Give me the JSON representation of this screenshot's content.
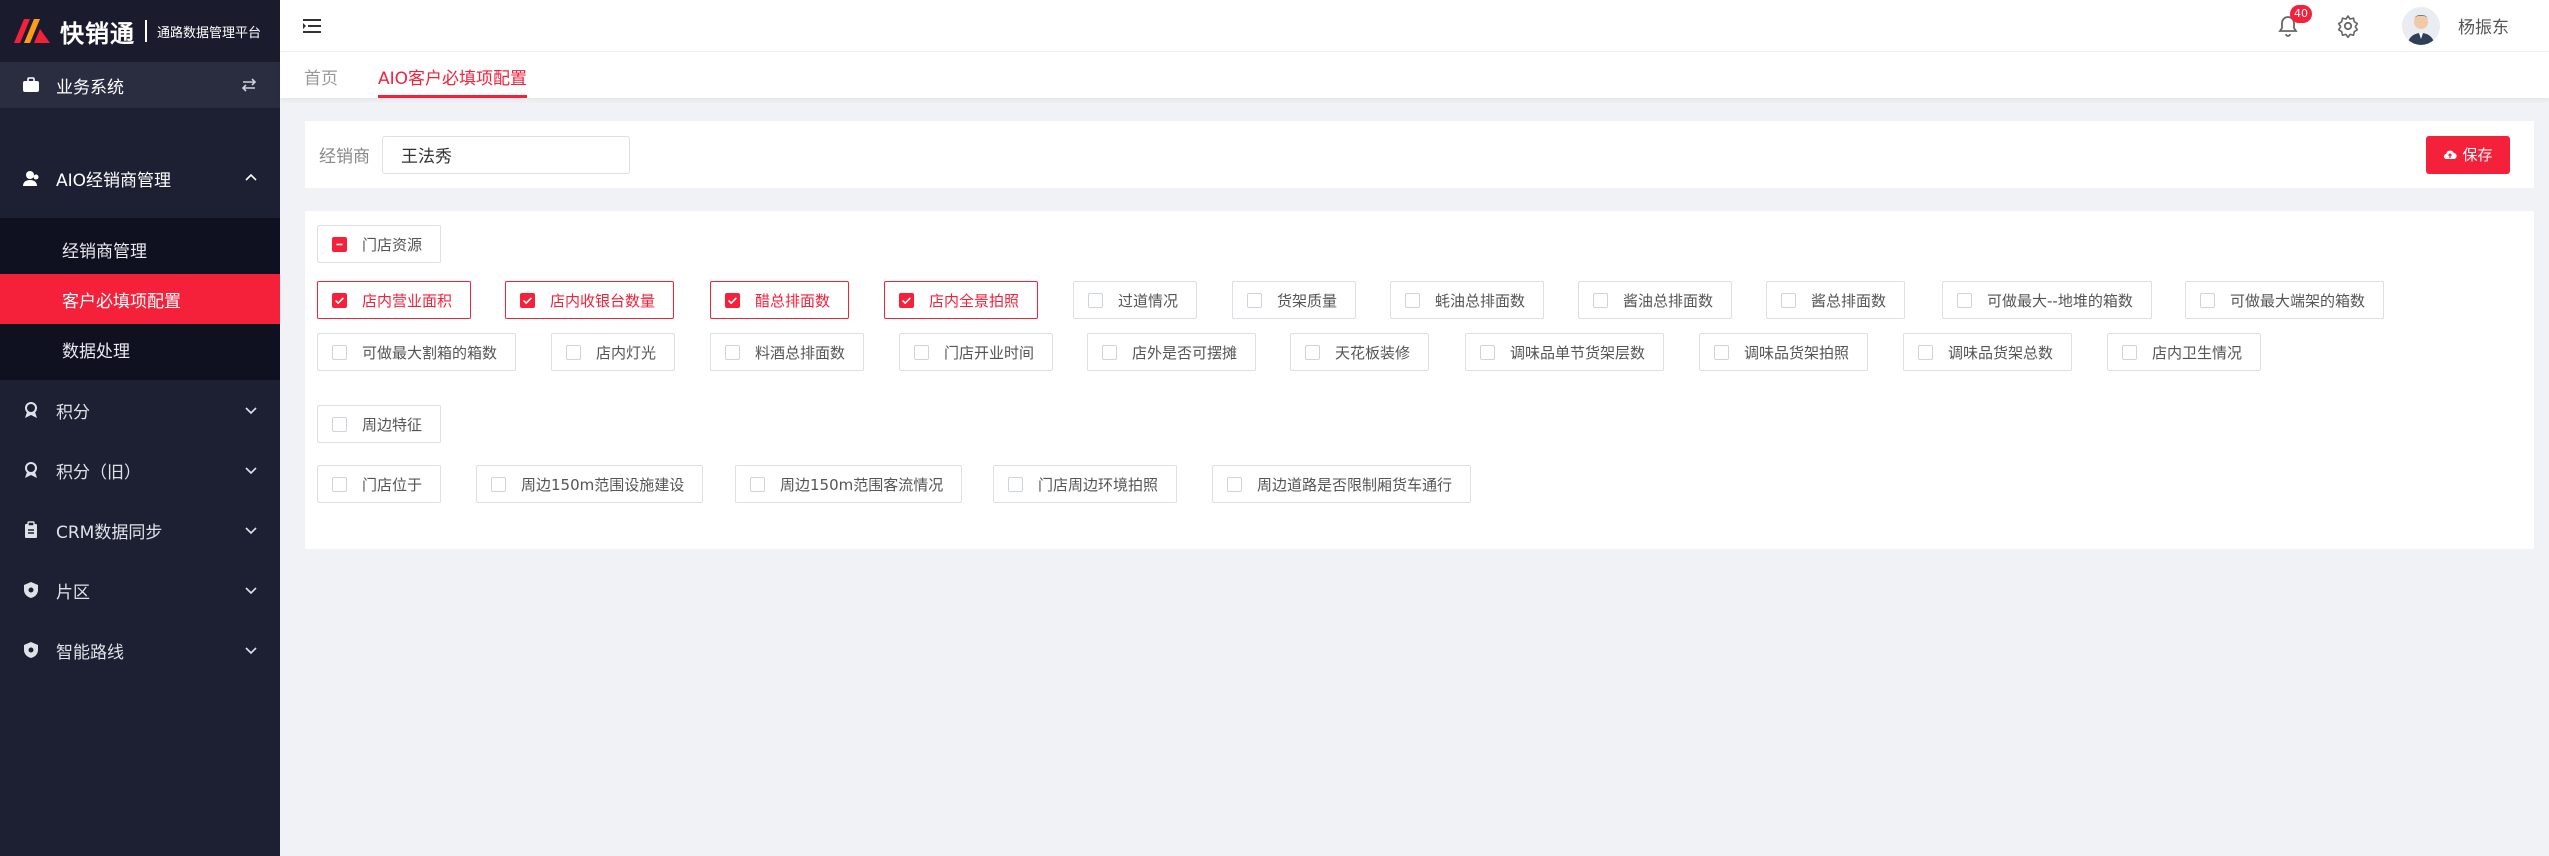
{
  "brand": {
    "name": "快销通",
    "subtitle": "通路数据管理平台"
  },
  "sidebar": {
    "business_system": "业务系统",
    "open_group": {
      "label": "AIO经销商管理",
      "items": [
        {
          "label": "经销商管理"
        },
        {
          "label": "客户必填项配置"
        },
        {
          "label": "数据处理"
        }
      ]
    },
    "groups": [
      {
        "label": "积分"
      },
      {
        "label": "积分（旧）"
      },
      {
        "label": "CRM数据同步"
      },
      {
        "label": "片区"
      },
      {
        "label": "智能路线"
      }
    ]
  },
  "header": {
    "notification_count": "40",
    "user_name": "杨振东"
  },
  "tabs": [
    {
      "label": "首页"
    },
    {
      "label": "AIO客户必填项配置"
    }
  ],
  "filter": {
    "label": "经销商",
    "value": "王法秀",
    "save_label": "保存"
  },
  "sections": {
    "store": {
      "title": "门店资源",
      "items": [
        "店内营业面积",
        "店内收银台数量",
        "醋总排面数",
        "店内全景拍照",
        "过道情况",
        "货架质量",
        "蚝油总排面数",
        "酱油总排面数",
        "酱总排面数",
        "可做最大--地堆的箱数",
        "可做最大端架的箱数",
        "可做最大割箱的箱数",
        "店内灯光",
        "料酒总排面数",
        "门店开业时间",
        "店外是否可摆摊",
        "天花板装修",
        "调味品单节货架层数",
        "调味品货架拍照",
        "调味品货架总数",
        "店内卫生情况"
      ]
    },
    "surround": {
      "title": "周边特征",
      "items": [
        "门店位于",
        "周边150m范围设施建设",
        "周边150m范围客流情况",
        "门店周边环境拍照",
        "周边道路是否限制厢货车通行"
      ]
    }
  },
  "colors": {
    "accent": "#f5203a",
    "sidebar_bg": "#1d2033"
  }
}
